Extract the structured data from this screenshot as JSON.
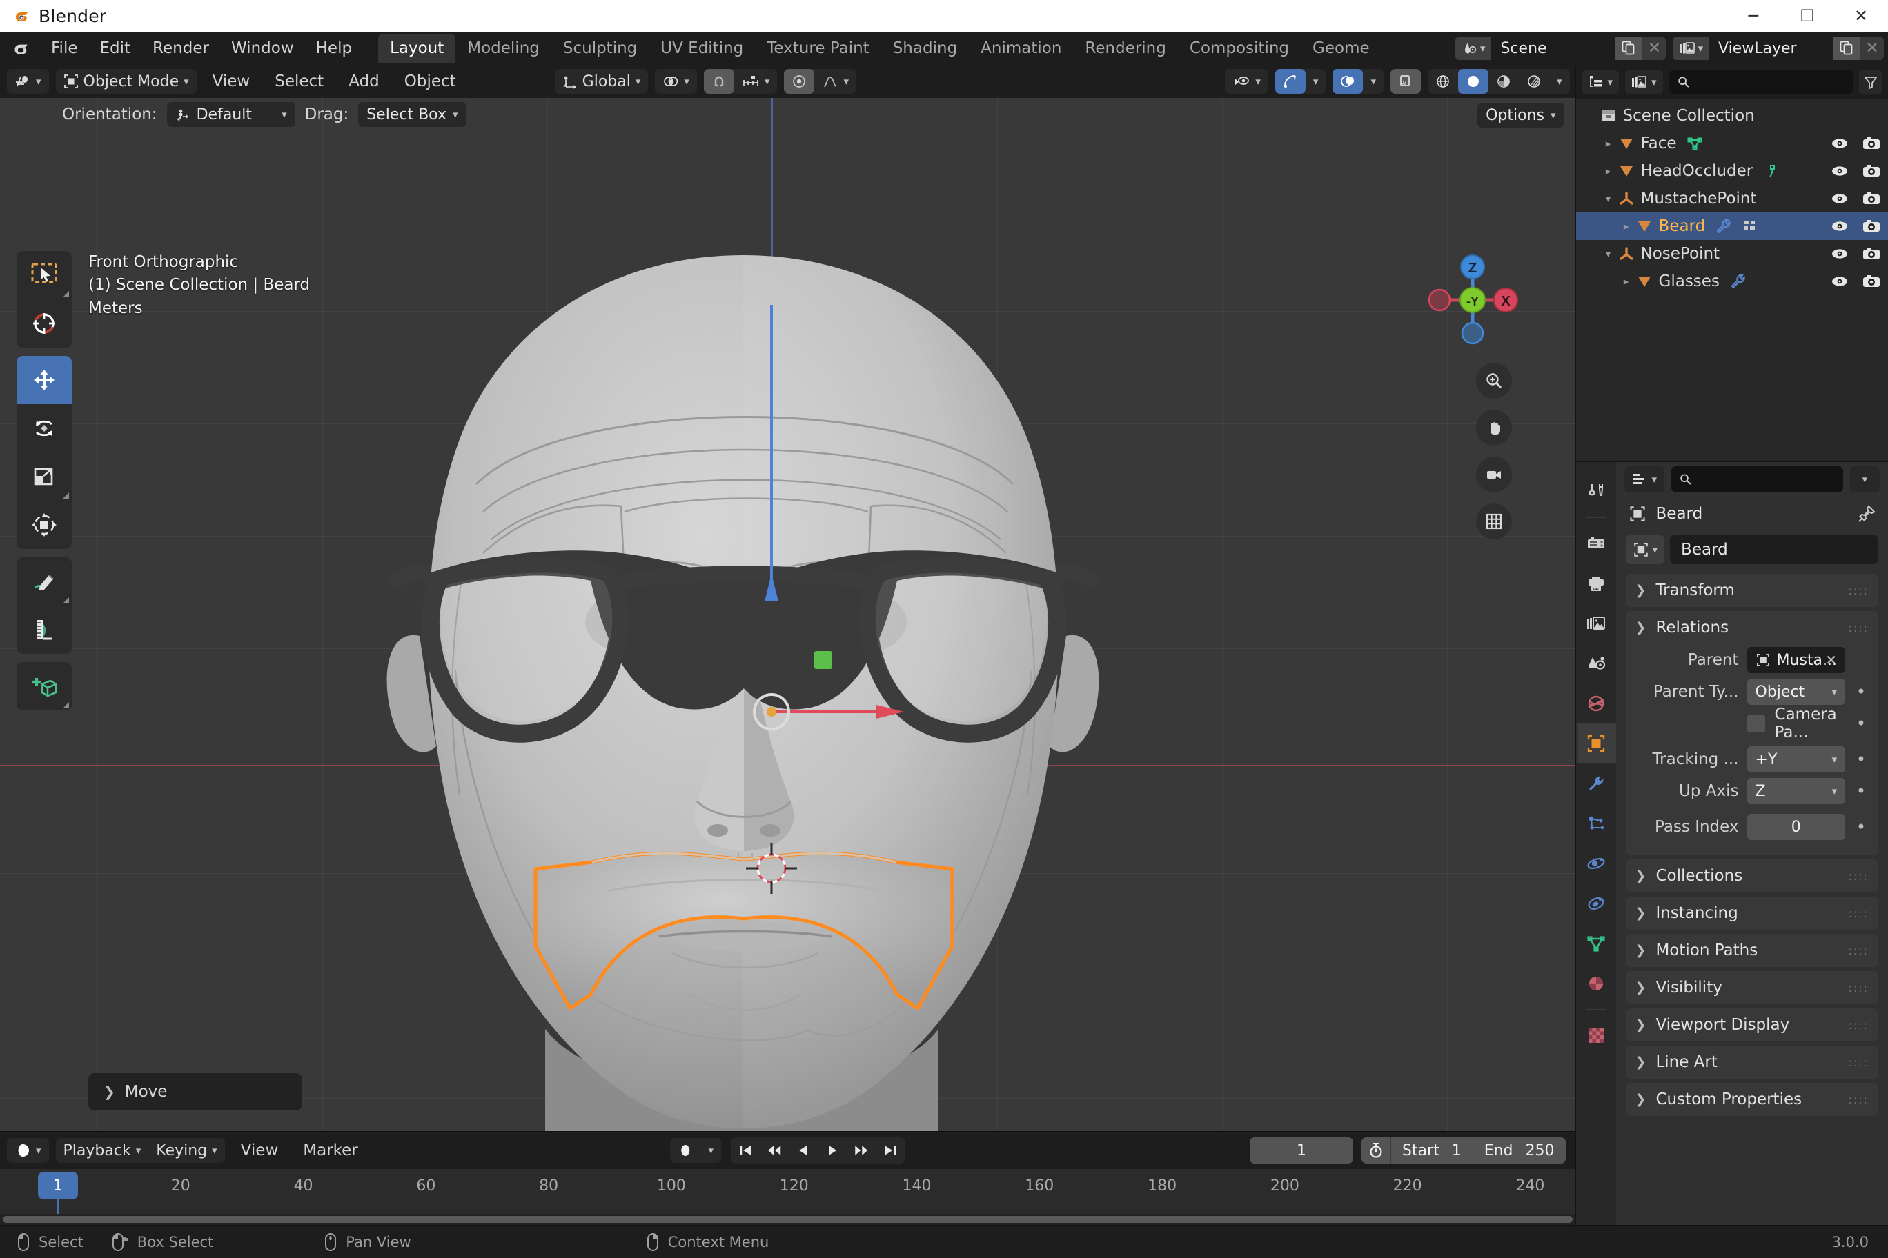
{
  "window": {
    "title": "Blender",
    "controls": {
      "minimize": "─",
      "maximize": "☐",
      "close": "✕"
    }
  },
  "topbar": {
    "menus": [
      "File",
      "Edit",
      "Render",
      "Window",
      "Help"
    ],
    "workspaces": [
      {
        "label": "Layout",
        "active": true
      },
      {
        "label": "Modeling",
        "active": false
      },
      {
        "label": "Sculpting",
        "active": false
      },
      {
        "label": "UV Editing",
        "active": false
      },
      {
        "label": "Texture Paint",
        "active": false
      },
      {
        "label": "Shading",
        "active": false
      },
      {
        "label": "Animation",
        "active": false
      },
      {
        "label": "Rendering",
        "active": false
      },
      {
        "label": "Compositing",
        "active": false
      },
      {
        "label": "Geome",
        "active": false
      }
    ],
    "scene": {
      "label": "Scene",
      "icon": "scene-icon"
    },
    "view_layer": {
      "label": "ViewLayer",
      "icon": "view-layer-icon"
    }
  },
  "viewport": {
    "header": {
      "editor_type_icon": "editor-type-3dview-icon",
      "mode": "Object Mode",
      "menus": [
        "View",
        "Select",
        "Add",
        "Object"
      ],
      "transform_orientation": "Global",
      "snap_icon": "magnet-icon",
      "proportional_icon": "proportional-edit-icon",
      "falloff_icon": "smooth-falloff-icon",
      "pivot_icon": "pivot-point-icon",
      "visibility_icon": "visibility-eye-icon",
      "gizmo_icon": "gizmo-icon",
      "overlays_icon": "overlays-icon",
      "xray_icon": "xray-icon",
      "shading_modes": [
        "wireframe",
        "solid",
        "material-preview",
        "rendered"
      ],
      "shading_active": "solid"
    },
    "tool_settings": {
      "orientation_label": "Orientation:",
      "orientation_value": "Default",
      "drag_label": "Drag:",
      "drag_value": "Select Box",
      "options_label": "Options"
    },
    "overlay_text": {
      "view": "Front Orthographic",
      "collection": "(1) Scene Collection | Beard",
      "units": "Meters"
    },
    "toolbar": [
      {
        "name": "tweak-tool",
        "icon": "cursor-select-box-icon",
        "active": false
      },
      {
        "name": "cursor-tool",
        "icon": "3d-cursor-icon",
        "active": false
      },
      {
        "name": "move-tool",
        "icon": "move-arrows-icon",
        "active": true
      },
      {
        "name": "rotate-tool",
        "icon": "rotate-icon",
        "active": false
      },
      {
        "name": "scale-tool",
        "icon": "scale-icon",
        "active": false
      },
      {
        "name": "transform-tool",
        "icon": "transform-icon",
        "active": false
      },
      {
        "name": "annotate-tool",
        "icon": "pencil-icon",
        "active": false
      },
      {
        "name": "measure-tool",
        "icon": "ruler-icon",
        "active": false
      },
      {
        "name": "add-cube-tool",
        "icon": "add-cube-icon",
        "active": false
      }
    ],
    "gizmo": {
      "z": "Z",
      "y": "-Y",
      "x": "X"
    },
    "nav_buttons": [
      "zoom-icon",
      "pan-hand-icon",
      "camera-icon",
      "grid-ortho-icon"
    ],
    "operator_panel": {
      "label": "Move"
    }
  },
  "timeline": {
    "editor_icon": "timeline-editor-icon",
    "menus": [
      "Playback",
      "Keying",
      "View",
      "Marker"
    ],
    "autokey_icon": "record-dot-icon",
    "transport": [
      "jump-start-icon",
      "prev-keyframe-icon",
      "play-reverse-icon",
      "play-icon",
      "next-keyframe-icon",
      "jump-end-icon"
    ],
    "current_frame": "1",
    "timer_icon": "stopwatch-icon",
    "start_label": "Start",
    "start_value": "1",
    "end_label": "End",
    "end_value": "250",
    "ticks": [
      "20",
      "40",
      "60",
      "80",
      "100",
      "120",
      "140",
      "160",
      "180",
      "200",
      "220",
      "240"
    ],
    "playhead_label": "1"
  },
  "outliner": {
    "display_mode_icon": "outliner-display-mode-icon",
    "filter_id_icon": "blender-file-icon",
    "search_placeholder": "",
    "filter_icon": "filter-funnel-icon",
    "root": {
      "label": "Scene Collection",
      "icon": "collection-icon"
    },
    "items": [
      {
        "label": "Face",
        "icon": "mesh-data-icon",
        "indent": 1,
        "disclosure": "collapsed",
        "selected": false,
        "extra_icons": [
          "mesh-data-green-icon"
        ]
      },
      {
        "label": "HeadOccluder",
        "icon": "mesh-data-icon",
        "indent": 1,
        "disclosure": "collapsed",
        "selected": false,
        "extra_icons": [
          "modifier-green-icon"
        ]
      },
      {
        "label": "MustachePoint",
        "icon": "empty-axis-icon",
        "indent": 1,
        "disclosure": "expanded",
        "selected": false,
        "extra_icons": []
      },
      {
        "label": "Beard",
        "icon": "mesh-data-icon",
        "indent": 2,
        "disclosure": "collapsed",
        "selected": true,
        "extra_icons": [
          "wrench-modifier-icon",
          "object-data-icon"
        ]
      },
      {
        "label": "NosePoint",
        "icon": "empty-axis-icon",
        "indent": 1,
        "disclosure": "expanded",
        "selected": false,
        "extra_icons": []
      },
      {
        "label": "Glasses",
        "icon": "mesh-data-icon",
        "indent": 2,
        "disclosure": "collapsed",
        "selected": false,
        "extra_icons": [
          "wrench-modifier-icon"
        ]
      }
    ],
    "row_toggles": [
      "eye-visibility-icon",
      "camera-render-icon"
    ]
  },
  "properties": {
    "search_placeholder": "",
    "tabs": [
      {
        "name": "tool-tab",
        "icon": "tool-screwdriver-wrench-icon",
        "active": false
      },
      {
        "name": "render-tab",
        "icon": "render-camera-back-icon",
        "active": false
      },
      {
        "name": "output-tab",
        "icon": "output-printer-icon",
        "active": false
      },
      {
        "name": "viewlayer-tab",
        "icon": "view-layer-images-icon",
        "active": false
      },
      {
        "name": "scene-tab",
        "icon": "scene-cone-sphere-icon",
        "active": false
      },
      {
        "name": "world-tab",
        "icon": "world-globe-icon",
        "active": false
      },
      {
        "name": "object-tab",
        "icon": "object-square-orange-icon",
        "active": true
      },
      {
        "name": "modifier-tab",
        "icon": "wrench-blue-icon",
        "active": false
      },
      {
        "name": "particles-tab",
        "icon": "particles-icon",
        "active": false
      },
      {
        "name": "physics-tab",
        "icon": "physics-orbit-icon",
        "active": false
      },
      {
        "name": "constraints-tab",
        "icon": "constraint-icon",
        "active": false
      },
      {
        "name": "data-tab",
        "icon": "mesh-data-green-icon",
        "active": false
      },
      {
        "name": "material-tab",
        "icon": "material-sphere-icon",
        "active": false
      },
      {
        "name": "texture-tab",
        "icon": "texture-checker-icon",
        "active": false
      }
    ],
    "breadcrumb": {
      "icon": "object-square-orange-icon",
      "label": "Beard",
      "pin_icon": "pin-icon"
    },
    "id_name": "Beard",
    "panels": [
      {
        "label": "Transform",
        "state": "collapsed"
      },
      {
        "label": "Relations",
        "state": "expanded"
      },
      {
        "label": "Collections",
        "state": "collapsed"
      },
      {
        "label": "Instancing",
        "state": "collapsed"
      },
      {
        "label": "Motion Paths",
        "state": "collapsed"
      },
      {
        "label": "Visibility",
        "state": "collapsed"
      },
      {
        "label": "Viewport Display",
        "state": "collapsed"
      },
      {
        "label": "Line Art",
        "state": "collapsed"
      },
      {
        "label": "Custom Properties",
        "state": "collapsed"
      }
    ],
    "relations": {
      "parent_label": "Parent",
      "parent_value": "Musta...",
      "parent_type_label": "Parent Ty...",
      "parent_type_value": "Object",
      "camera_parent_label": "Camera Pa...",
      "camera_parent_checked": false,
      "tracking_label": "Tracking ...",
      "tracking_value": "+Y",
      "up_axis_label": "Up Axis",
      "up_axis_value": "Z",
      "pass_index_label": "Pass Index",
      "pass_index_value": "0"
    }
  },
  "statusbar": {
    "items": [
      {
        "icon": "mouse-left-icon",
        "label": "Select"
      },
      {
        "icon": "mouse-drag-icon",
        "label": "Box Select"
      },
      {
        "icon": "mouse-middle-icon",
        "label": "Pan View"
      },
      {
        "icon": "mouse-right-icon",
        "label": "Context Menu"
      }
    ],
    "version": "3.0.0"
  },
  "colors": {
    "accent_blue": "#4772b3",
    "selected_orange": "#ffb547",
    "outliner_sel": "#3b5585",
    "bg_dark": "#1d1d1d",
    "bg_panel": "#303030",
    "viewport_bg": "#393939"
  }
}
